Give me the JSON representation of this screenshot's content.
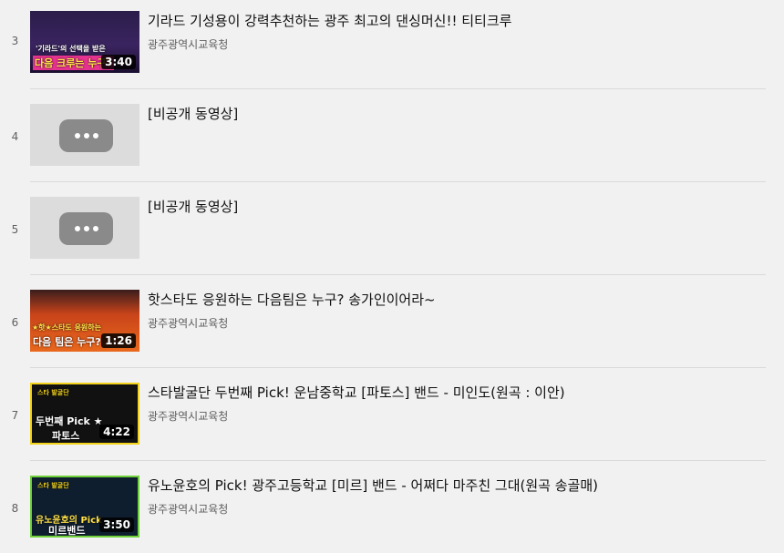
{
  "items": [
    {
      "index": "3",
      "title": "기라드 기성용이 강력추천하는 광주 최고의 댄싱머신!! 티티크루",
      "channel": "광주광역시교육청",
      "duration": "3:40",
      "thumb_texts": {
        "caption_top": "'기라드'의 선택을 받은",
        "caption_bottom": "다음 크루는 누구?"
      }
    },
    {
      "index": "4",
      "title": "[비공개 동영상]",
      "channel": "",
      "duration": ""
    },
    {
      "index": "5",
      "title": "[비공개 동영상]",
      "channel": "",
      "duration": ""
    },
    {
      "index": "6",
      "title": "핫스타도 응원하는 다음팀은 누구? 송가인이어라~",
      "channel": "광주광역시교육청",
      "duration": "1:26",
      "thumb_texts": {
        "caption_top": "★핫★스타도 응원하는",
        "caption_bottom": "다음 팀은 누구?"
      }
    },
    {
      "index": "7",
      "title": "스타발굴단 두번째 Pick! 운남중학교 [파토스] 밴드 - 미인도(원곡 : 이안)",
      "channel": "광주광역시교육청",
      "duration": "4:22",
      "thumb_texts": {
        "logo": "스타 발굴단",
        "caption_top": "두번째 Pick ★",
        "caption_bottom": "파토스"
      }
    },
    {
      "index": "8",
      "title": "유노윤호의 Pick! 광주고등학교 [미르] 밴드 - 어쩌다 마주친 그대(원곡 송골매)",
      "channel": "광주광역시교육청",
      "duration": "3:50",
      "thumb_texts": {
        "logo": "스타 발굴단",
        "caption_top": "유노윤호의 Pick",
        "caption_bottom": "미르밴드"
      }
    }
  ],
  "colors": {
    "background": "#f1f1f1",
    "divider": "#d9d9d9",
    "meta_text": "#606060"
  }
}
